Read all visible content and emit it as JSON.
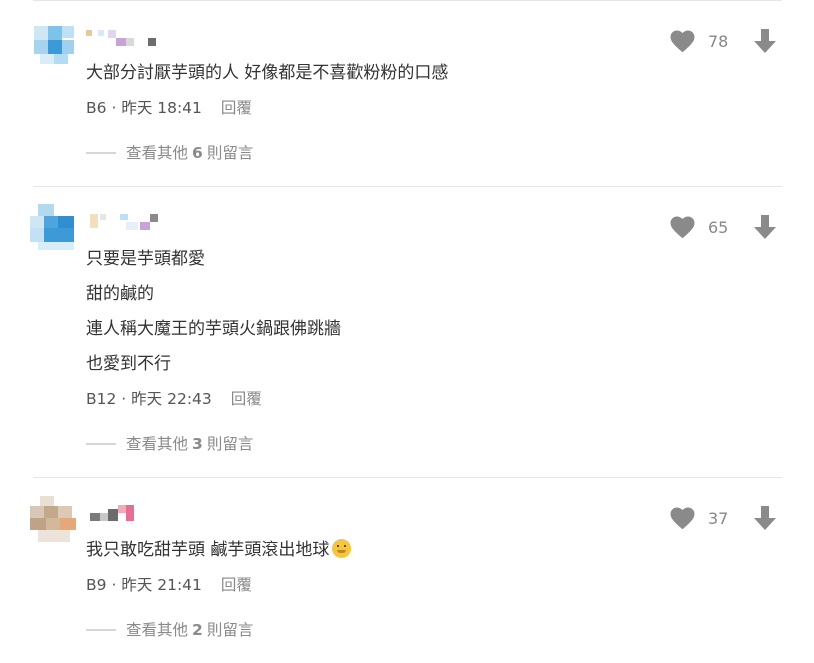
{
  "comments": [
    {
      "author": "",
      "body": [
        "大部分討厭芋頭的人 好像都是不喜歡粉粉的口感"
      ],
      "floor": "B6",
      "separator": "·",
      "time": "昨天 18:41",
      "reply_label": "回覆",
      "likes": "78",
      "more": {
        "prefix": "查看其他",
        "count": "6",
        "suffix": "則留言"
      }
    },
    {
      "author": "",
      "body": [
        "只要是芋頭都愛",
        "甜的鹹的",
        "連人稱大魔王的芋頭火鍋跟佛跳牆",
        "也愛到不行"
      ],
      "floor": "B12",
      "separator": "·",
      "time": "昨天 22:43",
      "reply_label": "回覆",
      "likes": "65",
      "more": {
        "prefix": "查看其他",
        "count": "3",
        "suffix": "則留言"
      }
    },
    {
      "author": "",
      "body": [
        "我只敢吃甜芋頭 鹹芋頭滾出地球"
      ],
      "body_emoji": "smiling-face-emoji",
      "floor": "B9",
      "separator": "·",
      "time": "昨天 21:41",
      "reply_label": "回覆",
      "likes": "37",
      "more": {
        "prefix": "查看其他",
        "count": "2",
        "suffix": "則留言"
      }
    }
  ],
  "icons": {
    "like": "heart-icon",
    "dislike": "down-arrow-icon"
  },
  "colors": {
    "icon_gray": "#8a8a8a",
    "text": "#333333",
    "meta": "#555555",
    "divider": "#e6e6e6"
  }
}
